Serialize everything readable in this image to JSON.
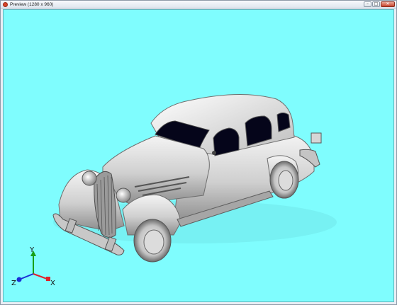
{
  "window": {
    "title": "Preview (1280 x 960)",
    "buttons": {
      "minimize": "–",
      "maximize": "□",
      "close": "✕"
    }
  },
  "viewport": {
    "background": "#7ffdfe",
    "model": "3d-car-render"
  },
  "axes": {
    "x": "X",
    "y": "Y",
    "z": "Z"
  },
  "colors": {
    "x_axis": "#e0202a",
    "y_axis": "#18a018",
    "z_axis": "#1a2fd6"
  }
}
